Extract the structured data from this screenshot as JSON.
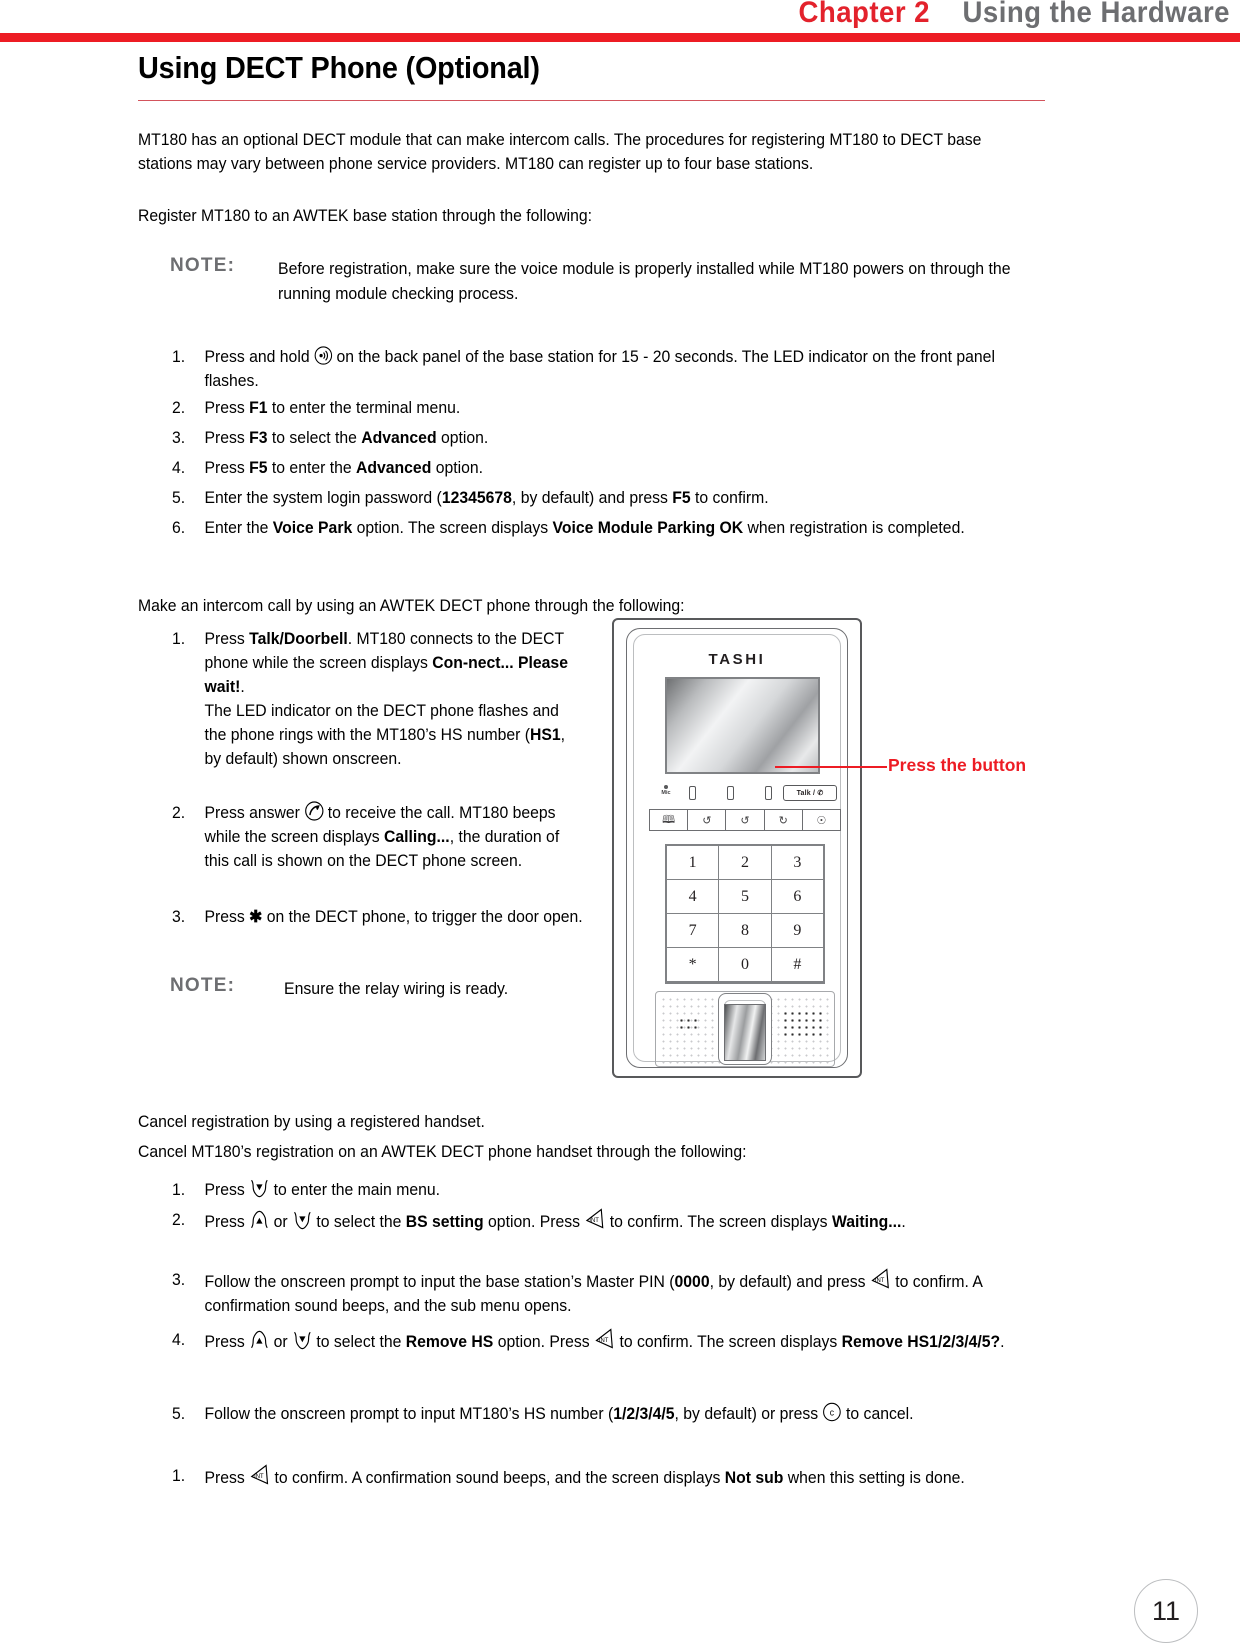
{
  "header": {
    "chapter": "Chapter 2",
    "title": "Using the Hardware",
    "rule_color": "#ed1c24"
  },
  "section": {
    "heading": "Using DECT Phone (Optional)"
  },
  "intro": {
    "p1": "MT180 has an optional DECT module that can make intercom calls. The procedures for registering MT180 to DECT base stations may vary between phone service providers. MT180 can register up to four base stations.",
    "p2": "Register MT180 to an AWTEK base station through the following:"
  },
  "note1": {
    "label": "NOTE:",
    "body": "Before registration, make sure the voice module is properly installed while MT180 powers on through the running module checking process."
  },
  "register_steps": [
    {
      "num": "1.",
      "pre": "Press and hold ",
      "icon": "wireless-signal-icon",
      "post": " on the back panel of the base station for 15 - 20 seconds. The LED indicator on the front panel flashes."
    },
    {
      "num": "2.",
      "text": "Press F1 to enter the terminal menu.",
      "bold": [
        "F1"
      ]
    },
    {
      "num": "3.",
      "text": "Press F3 to select the Advanced option.",
      "bold": [
        "F3",
        "Advanced"
      ]
    },
    {
      "num": "4.",
      "text": "Press F5 to enter the Advanced option.",
      "bold": [
        "F5",
        "Advanced"
      ]
    },
    {
      "num": "5.",
      "text": "Enter the system login password (12345678, by default) and press F5 to confirm.",
      "bold": [
        "12345678",
        "F5"
      ]
    },
    {
      "num": "6.",
      "text": "Enter the Voice Park option. The screen displays Voice Module Parking OK when registration is completed.",
      "bold": [
        "Voice Park",
        "Voice Module Parking OK"
      ]
    }
  ],
  "intercom": {
    "lead": "Make an intercom call by using an AWTEK DECT phone through the following:",
    "steps": [
      {
        "num": "1.",
        "segments": [
          "Press ",
          "Talk/Doorbell",
          ". MT180 connects to the DECT phone while the screen displays ",
          "Con-nect... Please wait!",
          ".",
          "The LED indicator on the DECT phone flashes and the phone rings with the MT180’s HS number (",
          "HS1",
          ", by default) shown onscreen."
        ]
      },
      {
        "num": "2.",
        "segments": [
          "Press answer ",
          "answer-call-icon",
          " to receive the call. MT180 beeps while the screen displays ",
          "Calling...",
          ", the duration of this call is shown on the DECT phone screen."
        ]
      },
      {
        "num": "3.",
        "segments": [
          "Press ",
          "✱",
          " on the DECT phone, to trigger the door open."
        ]
      }
    ]
  },
  "note2": {
    "label": "NOTE:",
    "body": "Ensure the relay wiring is ready."
  },
  "device": {
    "brand": "TASHI",
    "mic_label": "Mic",
    "talk_button": "Talk / ✆",
    "function_icons": [
      "book-icon",
      "call-back-icon",
      "call-forward-icon",
      "redial-icon",
      "globe-icon"
    ],
    "keypad": [
      [
        "1",
        "2",
        "3"
      ],
      [
        "4",
        "5",
        "6"
      ],
      [
        "7",
        "8",
        "9"
      ],
      [
        "*",
        "0",
        "#"
      ]
    ],
    "callout": "Press the button",
    "callout_color": "#ed1c24"
  },
  "cancel": {
    "lead1": "Cancel registration by using a registered handset.",
    "lead2": "Cancel MT180’s registration on an AWTEK DECT phone handset through the following:",
    "steps": [
      {
        "num": "1.",
        "text": "Press (down-arrow-key) to enter the main menu."
      },
      {
        "num": "2.",
        "text": "Press (up-arrow-key) or (down-arrow-key) to select the BS setting option. Press (int-key) to confirm. The screen displays Waiting....",
        "bold": [
          "BS setting",
          "Waiting..."
        ]
      },
      {
        "num": "3.",
        "text": "Follow the onscreen prompt to input the base station’s Master PIN (0000, by default) and press (int-key) to confirm. A confirmation sound beeps, and the sub menu opens.",
        "bold": [
          "0000"
        ]
      },
      {
        "num": "4.",
        "text": "Press (up-arrow-key) or (down-arrow-key) to select the Remove HS option. Press (int-key) to confirm. The screen displays Remove HS1/2/3/4/5?.",
        "bold": [
          "Remove HS",
          "Remove HS1/2/3/4/5?"
        ]
      },
      {
        "num": "5.",
        "text": "Follow the onscreen prompt to input MT180’s HS number (1/2/3/4/5, by default) or press (c-key) to cancel.",
        "bold": [
          "1/2/3/4/5"
        ]
      },
      {
        "num": "1.",
        "text": "Press (int-key) to confirm. A confirmation sound beeps, and the screen displays Not sub when this setting is done.",
        "bold": [
          "Not sub"
        ]
      }
    ]
  },
  "footer": {
    "page_number": "11"
  }
}
